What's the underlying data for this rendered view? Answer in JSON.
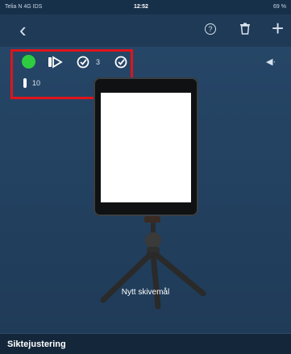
{
  "status_bar": {
    "carrier": "Telia N  4G  IDS",
    "time": "12:52",
    "battery": "69 %"
  },
  "nav": {
    "back_icon": "chevron-left-icon",
    "help_icon": "question-circle-icon",
    "trash_icon": "trash-icon",
    "add_icon": "plus-icon"
  },
  "indicators": {
    "status_color": "#2ecc40",
    "shot_count": "3",
    "temperature": "10",
    "highlight_color": "#e0141b"
  },
  "target": {
    "name": "Nytt skivemål"
  },
  "footer": {
    "title": "Siktejustering"
  }
}
